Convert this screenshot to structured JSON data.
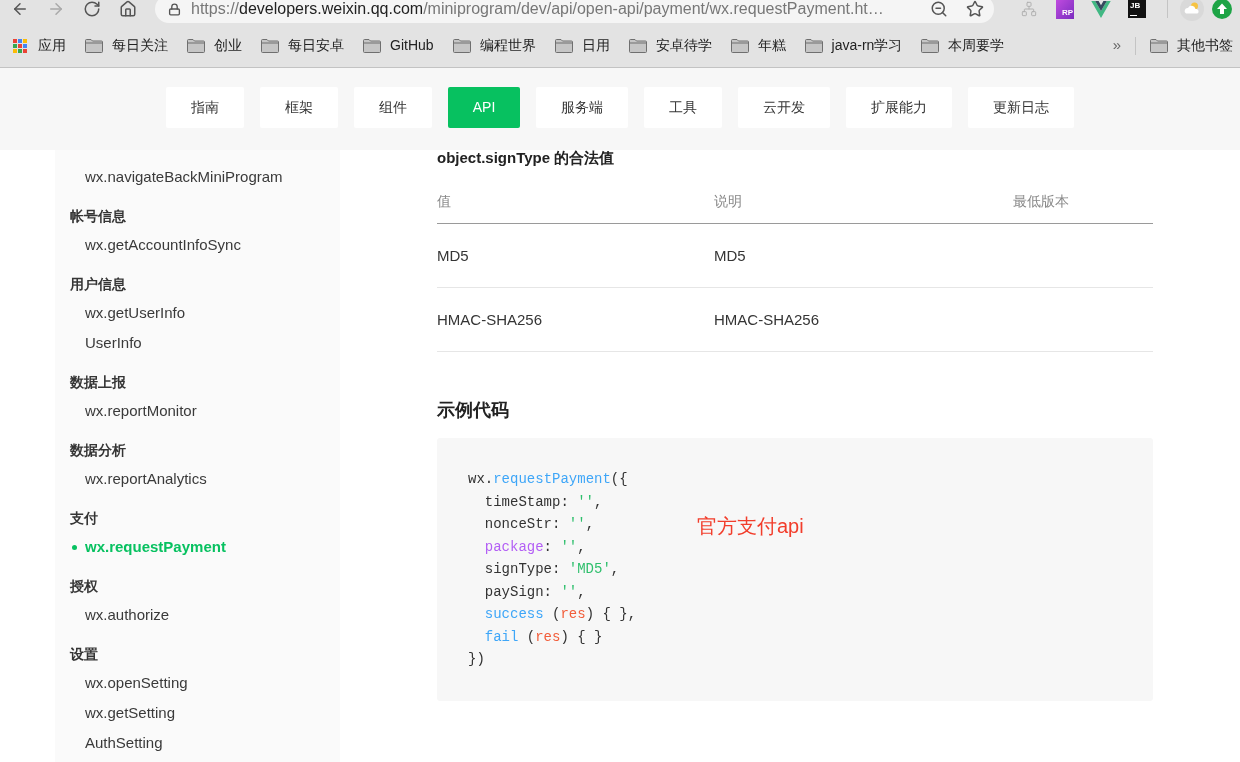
{
  "browser": {
    "nav_buttons": [
      {
        "kind": "back",
        "disabled": false
      },
      {
        "kind": "forward",
        "disabled": true
      },
      {
        "kind": "reload",
        "disabled": false
      },
      {
        "kind": "home",
        "disabled": false
      }
    ],
    "url": {
      "scheme": "https://",
      "host": "developers.weixin.qq.com",
      "path": "/miniprogram/dev/api/open-api/payment/wx.requestPayment.ht…"
    },
    "extensions": [
      {
        "kind": "network"
      },
      {
        "kind": "purple-tile",
        "text": "RP"
      },
      {
        "kind": "v-logo"
      },
      {
        "kind": "black-tile",
        "text": "JB"
      },
      {
        "kind": "separator"
      },
      {
        "kind": "weather"
      },
      {
        "kind": "update"
      }
    ]
  },
  "bookmarks": {
    "apps_label": "应用",
    "folders": [
      "每日关注",
      "创业",
      "每日安卓",
      "GitHub",
      "编程世界",
      "日用",
      "安卓待学",
      "年糕",
      "java-rn学习",
      "本周要学"
    ],
    "overflow": "»",
    "other_folder": "其他书签"
  },
  "nav_tabs": [
    {
      "label": "指南",
      "selected": false
    },
    {
      "label": "框架",
      "selected": false
    },
    {
      "label": "组件",
      "selected": false
    },
    {
      "label": "API",
      "selected": true
    },
    {
      "label": "服务端",
      "selected": false
    },
    {
      "label": "工具",
      "selected": false
    },
    {
      "label": "云开发",
      "selected": false
    },
    {
      "label": "扩展能力",
      "selected": false
    },
    {
      "label": "更新日志",
      "selected": false
    }
  ],
  "sidebar": {
    "sections": [
      {
        "items": [
          {
            "label": "wx.navigateBackMiniProgram",
            "selected": false
          }
        ]
      },
      {
        "title": "帐号信息",
        "items": [
          {
            "label": "wx.getAccountInfoSync",
            "selected": false
          }
        ]
      },
      {
        "title": "用户信息",
        "items": [
          {
            "label": "wx.getUserInfo",
            "selected": false
          },
          {
            "label": "UserInfo",
            "selected": false
          }
        ]
      },
      {
        "title": "数据上报",
        "items": [
          {
            "label": "wx.reportMonitor",
            "selected": false
          }
        ]
      },
      {
        "title": "数据分析",
        "items": [
          {
            "label": "wx.reportAnalytics",
            "selected": false
          }
        ]
      },
      {
        "title": "支付",
        "items": [
          {
            "label": "wx.requestPayment",
            "selected": true
          }
        ]
      },
      {
        "title": "授权",
        "items": [
          {
            "label": "wx.authorize",
            "selected": false
          }
        ]
      },
      {
        "title": "设置",
        "items": [
          {
            "label": "wx.openSetting",
            "selected": false
          },
          {
            "label": "wx.getSetting",
            "selected": false
          },
          {
            "label": "AuthSetting",
            "selected": false
          }
        ]
      }
    ]
  },
  "content": {
    "table_caption": "object.signType 的合法值",
    "table": {
      "columns": [
        "值",
        "说明",
        "最低版本"
      ],
      "rows": [
        [
          "MD5",
          "MD5"
        ],
        [
          "HMAC-SHA256",
          "HMAC-SHA256"
        ]
      ]
    },
    "example_title": "示例代码",
    "code_lines": [
      {
        "indented": false,
        "tokens": [
          {
            "text": "wx.",
            "kind": "plain"
          },
          {
            "text": "requestPayment",
            "kind": "function"
          },
          {
            "text": "({",
            "kind": "plain"
          }
        ]
      },
      {
        "indented": true,
        "tokens": [
          {
            "text": "timeStamp: ",
            "kind": "plain"
          },
          {
            "text": "''",
            "kind": "string"
          },
          {
            "text": ",",
            "kind": "plain"
          }
        ]
      },
      {
        "indented": true,
        "tokens": [
          {
            "text": "nonceStr: ",
            "kind": "plain"
          },
          {
            "text": "''",
            "kind": "string"
          },
          {
            "text": ",",
            "kind": "plain"
          }
        ]
      },
      {
        "indented": true,
        "tokens": [
          {
            "text": "package",
            "kind": "keyword"
          },
          {
            "text": ": ",
            "kind": "plain"
          },
          {
            "text": "''",
            "kind": "string"
          },
          {
            "text": ",",
            "kind": "plain"
          }
        ]
      },
      {
        "indented": true,
        "tokens": [
          {
            "text": "signType: ",
            "kind": "plain"
          },
          {
            "text": "'MD5'",
            "kind": "string"
          },
          {
            "text": ",",
            "kind": "plain"
          }
        ]
      },
      {
        "indented": true,
        "tokens": [
          {
            "text": "paySign: ",
            "kind": "plain"
          },
          {
            "text": "''",
            "kind": "string"
          },
          {
            "text": ",",
            "kind": "plain"
          }
        ]
      },
      {
        "indented": true,
        "tokens": [
          {
            "text": "success",
            "kind": "function"
          },
          {
            "text": " (",
            "kind": "plain"
          },
          {
            "text": "res",
            "kind": "param"
          },
          {
            "text": ") { },",
            "kind": "plain"
          }
        ]
      },
      {
        "indented": true,
        "tokens": [
          {
            "text": "fail",
            "kind": "function"
          },
          {
            "text": " (",
            "kind": "plain"
          },
          {
            "text": "res",
            "kind": "param"
          },
          {
            "text": ") { }",
            "kind": "plain"
          }
        ]
      },
      {
        "indented": false,
        "tokens": [
          {
            "text": "})",
            "kind": "plain"
          }
        ]
      }
    ],
    "annotation": "官方支付api"
  }
}
